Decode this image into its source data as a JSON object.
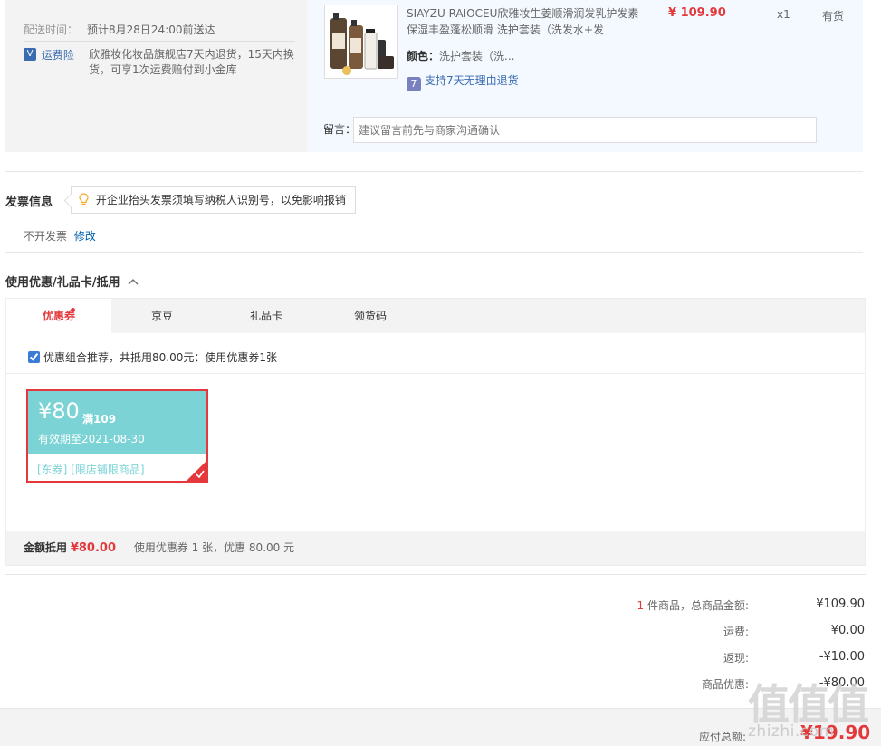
{
  "shipping": {
    "label": "配送时间：",
    "value": "预计8月28日24:00前送达"
  },
  "insurance": {
    "badge": "V",
    "link": "运费险",
    "desc": "欣雅妆化妆品旗舰店7天内退货，15天内换货，可享1次运费赔付到小金库"
  },
  "product": {
    "title": "SIAYZU RAIOCEU欣雅妆生姜顺滑润发乳护发素 保湿丰盈蓬松顺滑 洗护套装（洗发水+发",
    "price": "¥ 109.90",
    "qty": "x1",
    "stock": "有货",
    "color_label": "颜色：",
    "color_value": "洗护套装（洗...",
    "return_icon": "7",
    "return_text": "支持7天无理由退货",
    "message_label": "留言：",
    "message_placeholder": "建议留言前先与商家沟通确认"
  },
  "invoice": {
    "title": "发票信息",
    "tip": "开企业抬头发票须填写纳税人识别号，以免影响报销",
    "value": "不开发票",
    "edit": "修改"
  },
  "coupon_section": {
    "title": "使用优惠/礼品卡/抵用",
    "tabs": [
      "优惠券",
      "京豆",
      "礼品卡",
      "领货码"
    ],
    "recommend": "优惠组合推荐，共抵用80.00元：使用优惠券1张",
    "recommend_checked": true,
    "coupon": {
      "amount": "¥80",
      "condition": "满109",
      "valid": "有效期至2021-08-30",
      "tags": "[东券]  [限店铺限商品]"
    },
    "footer_label": "金额抵用",
    "footer_amount": "¥80.00",
    "footer_desc": "使用优惠券 1 张，优惠 80.00 元"
  },
  "summary": {
    "count": "1",
    "count_suffix": " 件商品，总商品金额:",
    "goods_total": "¥109.90",
    "freight_label": "运费:",
    "freight": "¥0.00",
    "cashback_label": "返现:",
    "cashback": "-¥10.00",
    "discount_label": "商品优惠:",
    "discount": "-¥80.00",
    "payable_label": "应付总额:",
    "payable": "¥19.90"
  },
  "watermark": {
    "logo": "值值值",
    "text": "zhizhi.com"
  },
  "colors": {
    "accent_red": "#e4393c",
    "coupon_teal": "#7cd3d6",
    "link_blue": "#005ea7"
  }
}
